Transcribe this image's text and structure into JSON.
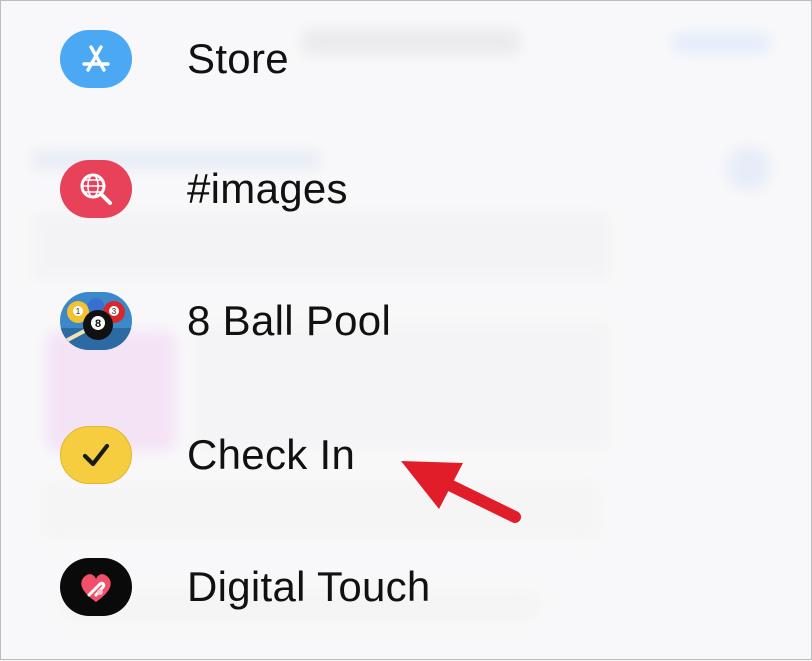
{
  "colors": {
    "store_icon": "#4aa8f5",
    "images_icon": "#e8415a",
    "pool_icon": "#3b89c9",
    "checkin_icon": "#f6cd3f",
    "digital_touch_icon": "#0a0a0a",
    "arrow": "#e21d2a"
  },
  "apps": [
    {
      "label": "Store",
      "icon": "app-store-icon"
    },
    {
      "label": "#images",
      "icon": "globe-search-icon"
    },
    {
      "label": "8 Ball Pool",
      "icon": "eight-ball-pool-icon"
    },
    {
      "label": "Check In",
      "icon": "checkmark-icon"
    },
    {
      "label": "Digital Touch",
      "icon": "heart-hand-icon"
    }
  ]
}
